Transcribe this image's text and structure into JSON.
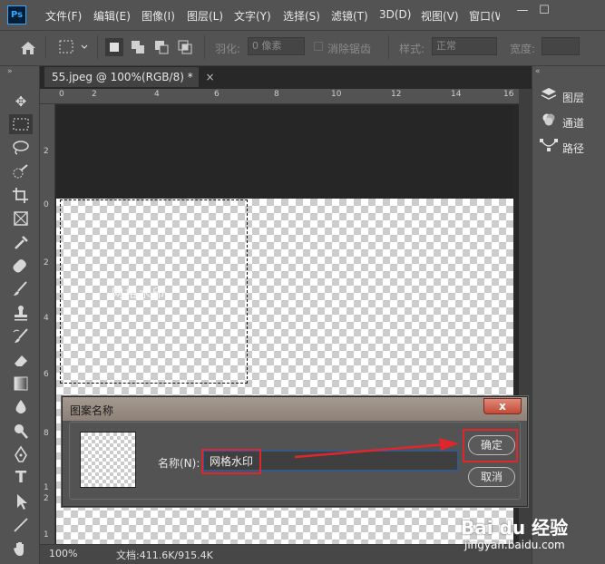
{
  "app": {
    "logo": "Ps"
  },
  "menu": [
    "文件(F)",
    "编辑(E)",
    "图像(I)",
    "图层(L)",
    "文字(Y)",
    "选择(S)",
    "滤镜(T)",
    "3D(D)",
    "视图(V)",
    "窗口(W)"
  ],
  "window_controls": {
    "minimize": "—",
    "maximize": "☐"
  },
  "options": {
    "feather_label": "羽化:",
    "feather_value": "0 像素",
    "antialias_label": "消除锯齿",
    "style_label": "样式:",
    "style_value": "正常",
    "width_label": "宽度:"
  },
  "document": {
    "tab_title": "55.jpeg @ 100%(RGB/8) *",
    "tab_close": "×",
    "ruler_top": [
      "0",
      "2",
      "4",
      "6",
      "8",
      "10",
      "12",
      "14",
      "16"
    ],
    "ruler_left": [
      "2",
      "0",
      "2",
      "4",
      "6",
      "8",
      "1",
      "2",
      "1"
    ],
    "canvas_text": "网格水印",
    "zoom": "100%",
    "doc_info": "文档:411.6K/915.4K"
  },
  "panels": [
    {
      "label": "图层",
      "icon": "layers-icon"
    },
    {
      "label": "通道",
      "icon": "channels-icon"
    },
    {
      "label": "路径",
      "icon": "paths-icon"
    }
  ],
  "dialog": {
    "title": "图案名称",
    "close": "x",
    "name_label": "名称(N):",
    "name_value": "网格水印",
    "ok_label": "确定",
    "cancel_label": "取消"
  },
  "watermark": {
    "brand": "Bai du 经验",
    "url": "jingyan.baidu.com"
  },
  "colors": {
    "highlight": "#e0262d",
    "input_border": "#1a5fb4",
    "title_bar": "#9a8e84"
  }
}
